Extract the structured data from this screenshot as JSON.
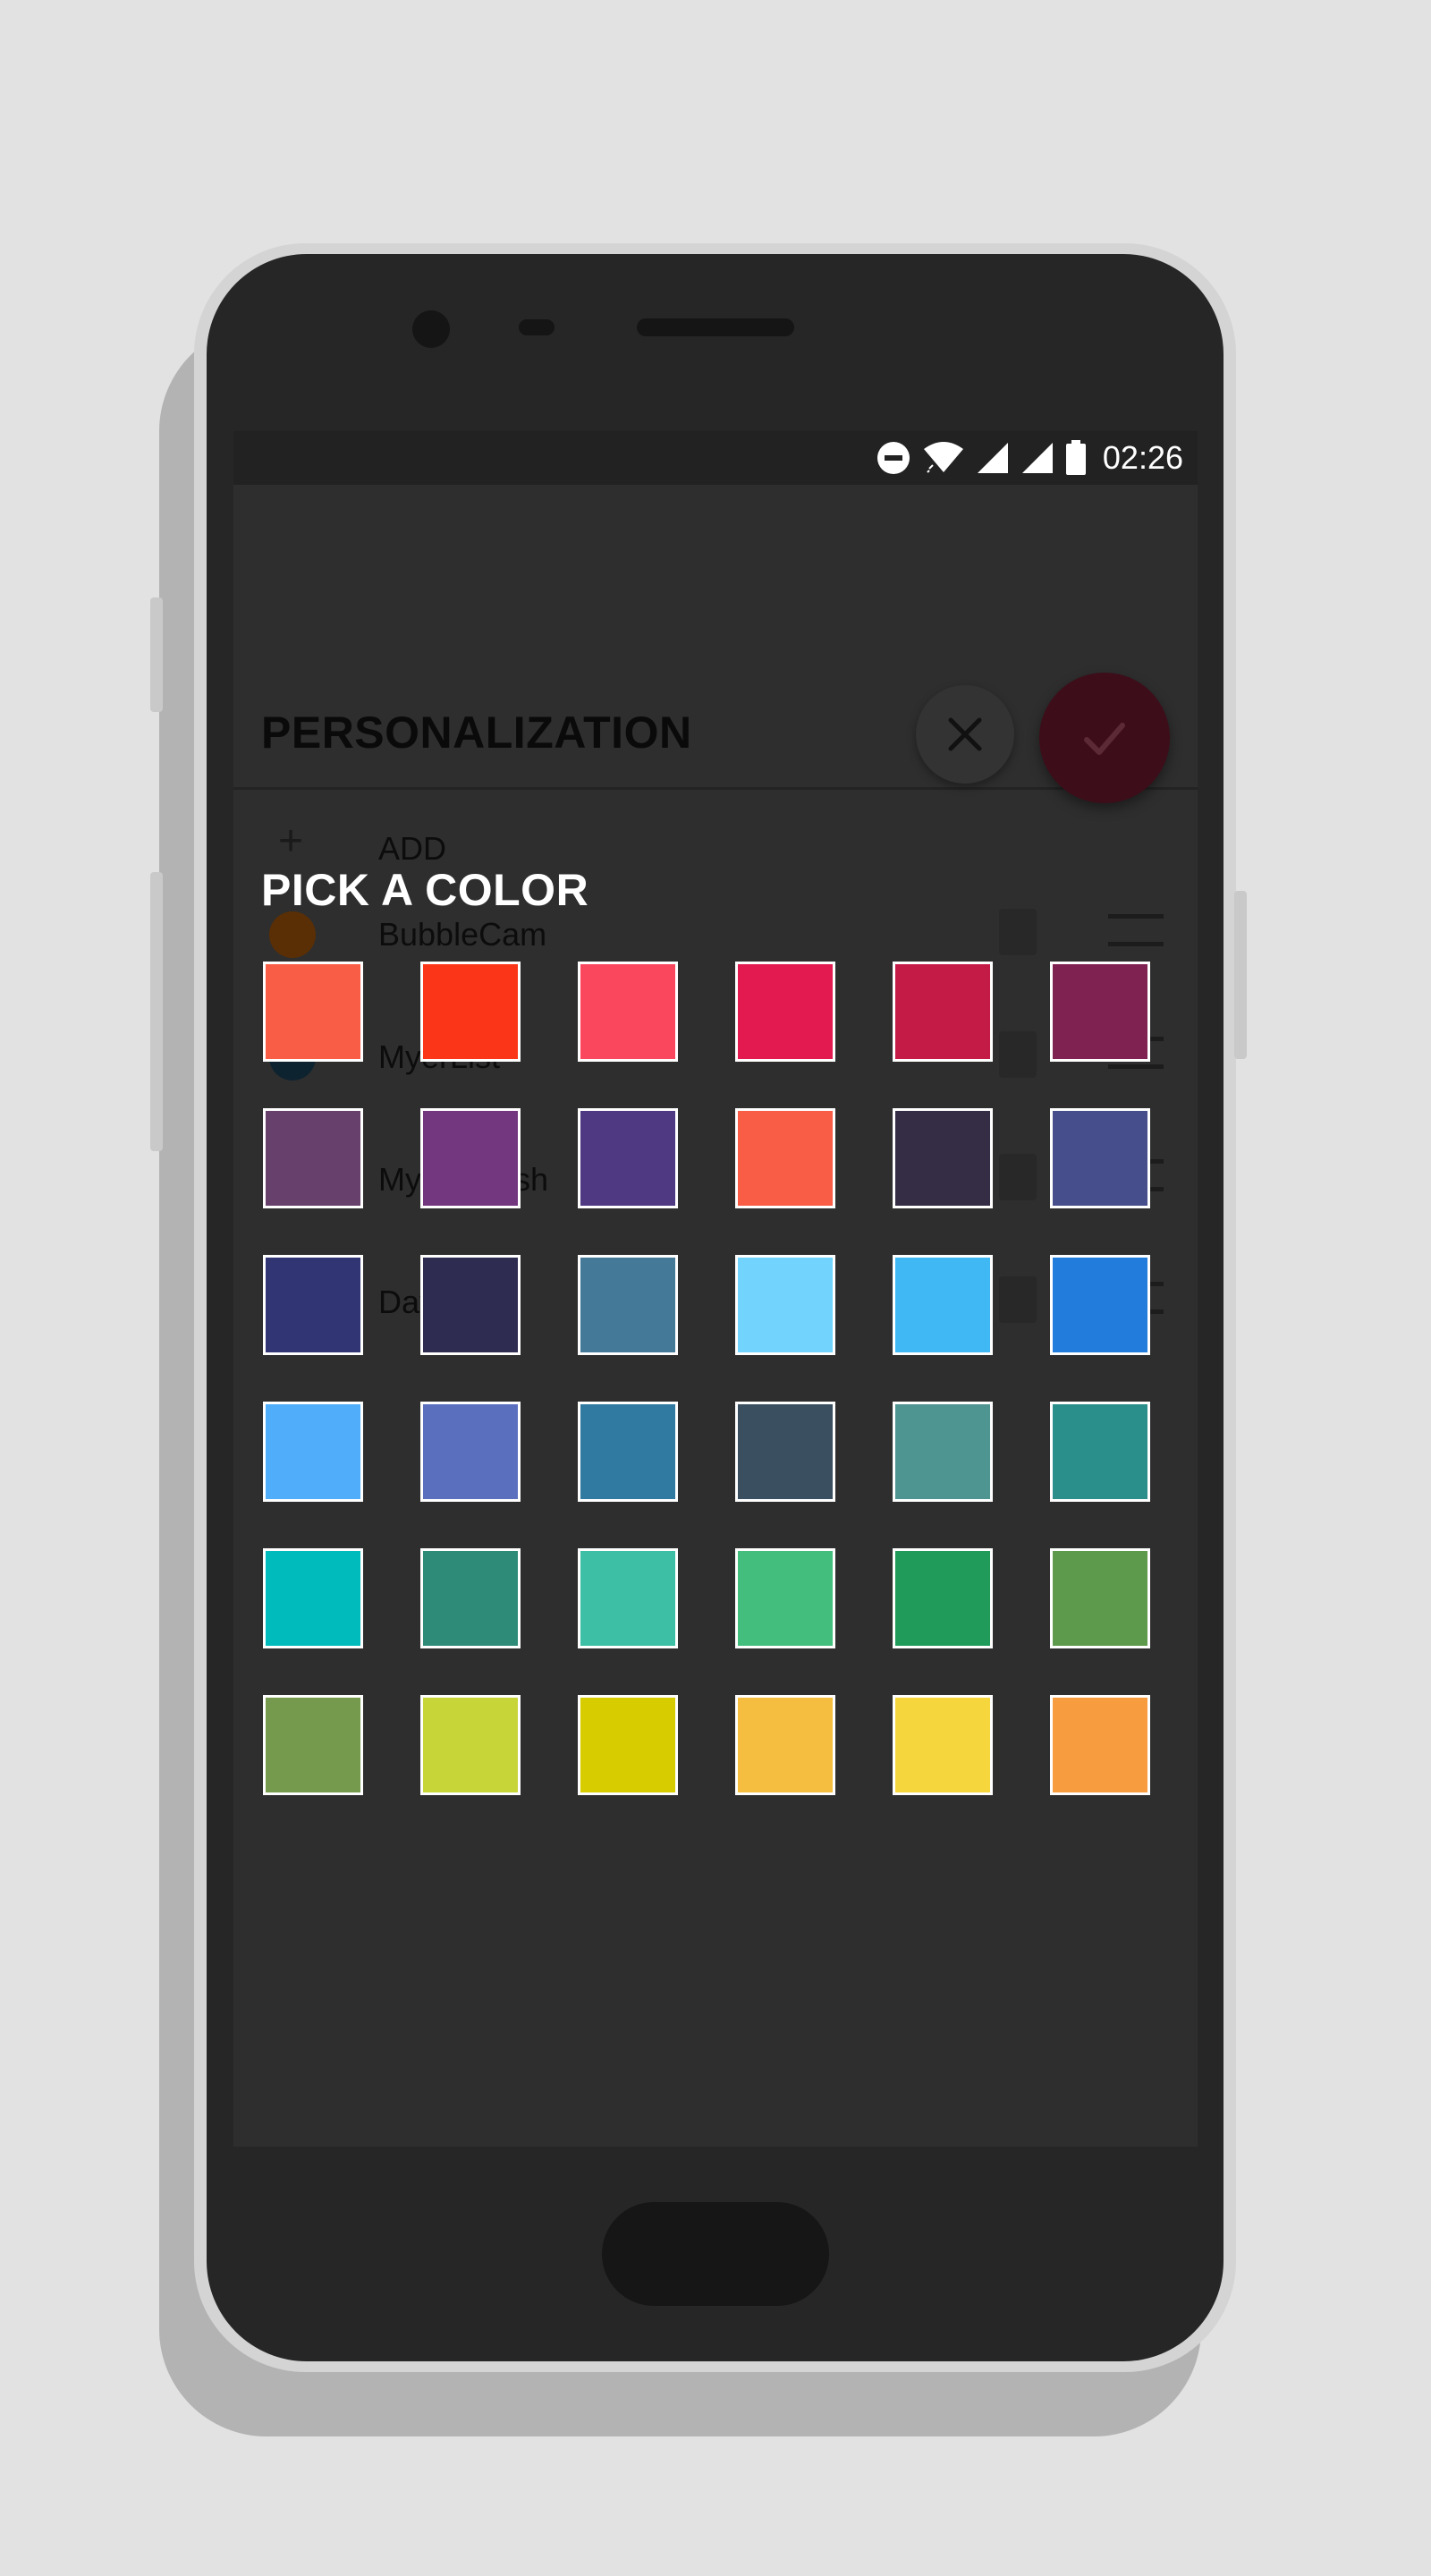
{
  "status_bar": {
    "time": "02:26",
    "icons": [
      "do-not-disturb-icon",
      "wifi-icon",
      "cell-signal-icon",
      "cell-signal-icon",
      "battery-icon"
    ]
  },
  "background_app": {
    "title": "PERSONALIZATION",
    "add_label": "ADD",
    "items": [
      {
        "label": "BubbleCam",
        "color": "#5a2f05"
      },
      {
        "label": "MyerList",
        "color": "#0e2330"
      },
      {
        "label": "MyerSplash",
        "color": "#06262a"
      },
      {
        "label": "Day",
        "color": "#1f1f1f"
      }
    ]
  },
  "dialog": {
    "title": "PICK A COLOR",
    "cancel_icon": "close-icon",
    "confirm_icon": "check-icon",
    "confirm_color": "#3e0d1a",
    "swatches": [
      "#FA5D45",
      "#FB3517",
      "#FA475E",
      "#E21A4F",
      "#C41B46",
      "#7F2151",
      "#68406C",
      "#733780",
      "#4F3983",
      "#FA5D45",
      "#342D45",
      "#474E8C",
      "#313574",
      "#2E2D51",
      "#447A98",
      "#72D4FC",
      "#3FB8F4",
      "#227CDB",
      "#4FADFA",
      "#5B6FBF",
      "#307AA2",
      "#3A5060",
      "#4E9491",
      "#2A8F8B",
      "#00BBBC",
      "#2E8B77",
      "#3DBFA5",
      "#43BE7D",
      "#209B59",
      "#5E9A4B",
      "#759A4D",
      "#C7D538",
      "#D6CC00",
      "#F6BE40",
      "#F6D63D",
      "#F89D3F"
    ]
  }
}
